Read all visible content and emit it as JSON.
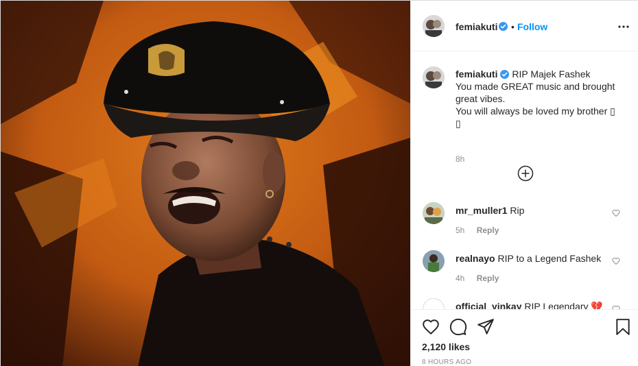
{
  "header": {
    "username": "femiakuti",
    "separator": "•",
    "follow_label": "Follow"
  },
  "caption": {
    "username": "femiakuti",
    "lines": [
      "RIP Majek Fashek",
      "You made GREAT music and brought great vibes.",
      "You will always be loved my brother ▯",
      "▯"
    ],
    "time": "8h"
  },
  "comments": [
    {
      "username": "mr_muller1",
      "text": "Rip",
      "time": "5h",
      "reply_label": "Reply"
    },
    {
      "username": "realnayo",
      "text": "RIP to a Legend Fashek",
      "time": "4h",
      "reply_label": "Reply"
    },
    {
      "username": "official_yinkay",
      "text": "RIP Legendary 💔",
      "time": "",
      "reply_label": ""
    }
  ],
  "footer": {
    "likes": "2,120 likes",
    "posted_ago": "8 HOURS AGO"
  },
  "icons": {
    "verified": "verified-badge-icon",
    "more": "more-options-icon",
    "load_more": "load-more-comments-icon",
    "like": "heart-icon",
    "comment": "comment-icon",
    "share": "share-icon",
    "save": "bookmark-icon"
  },
  "colors": {
    "link_blue": "#0095f6",
    "verified_blue": "#3897f0",
    "muted_gray": "#8e8e8e",
    "text": "#262626"
  }
}
